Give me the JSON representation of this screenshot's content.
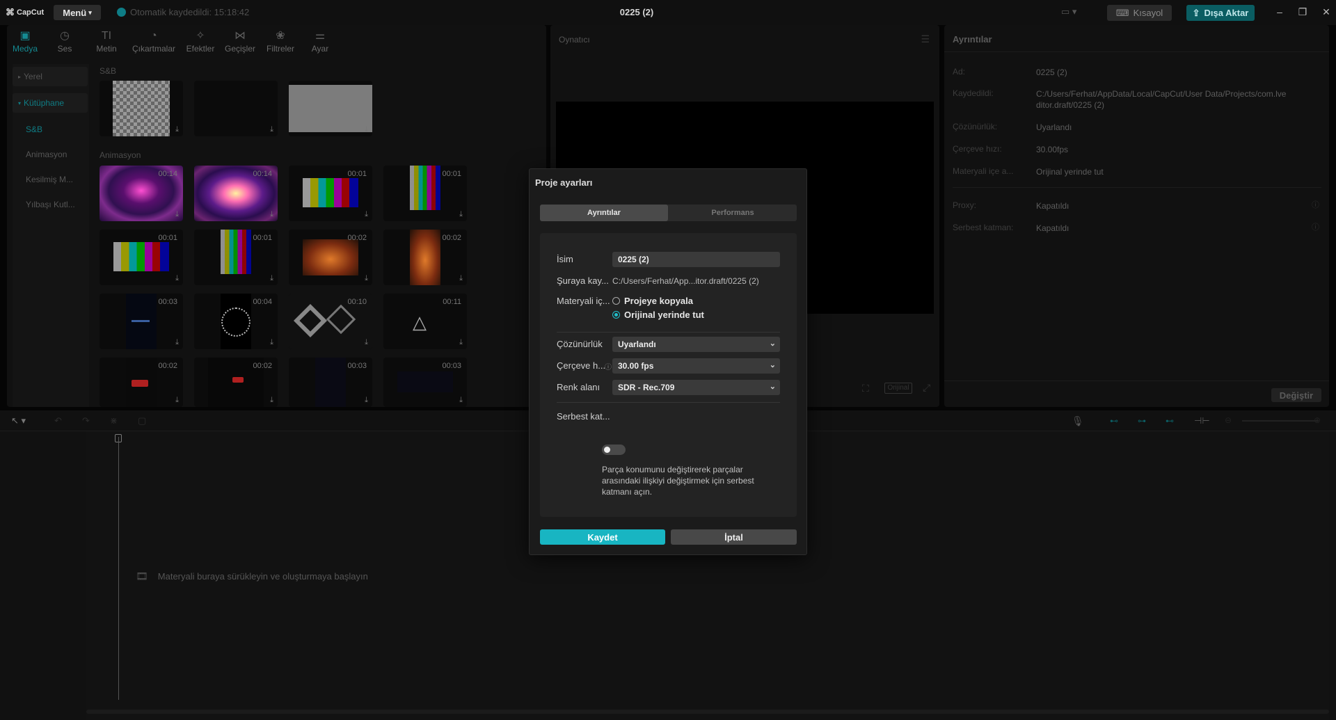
{
  "app": {
    "logo": "CapCut",
    "menu_label": "Menü",
    "autosave_text": "Otomatik kaydedildi: 15:18:42",
    "project_title": "0225 (2)",
    "shortcut_label": "Kısayol",
    "export_label": "Dışa Aktar"
  },
  "toolbar": {
    "items": [
      {
        "label": "Medya",
        "icon": "media-icon"
      },
      {
        "label": "Ses",
        "icon": "audio-icon"
      },
      {
        "label": "Metin",
        "icon": "text-icon"
      },
      {
        "label": "Çıkartmalar",
        "icon": "sticker-icon"
      },
      {
        "label": "Efektler",
        "icon": "effects-icon"
      },
      {
        "label": "Geçişler",
        "icon": "transitions-icon"
      },
      {
        "label": "Filtreler",
        "icon": "filters-icon"
      },
      {
        "label": "Ayar",
        "icon": "adjust-icon"
      }
    ]
  },
  "sidenav": {
    "local": "Yerel",
    "library": "Kütüphane",
    "items": [
      "S&B",
      "Animasyon",
      "Kesilmiş M...",
      "Yılbaşı Kutl..."
    ]
  },
  "media": {
    "section_sb": "S&B",
    "section_anim": "Animasyon",
    "durations": [
      "00:14",
      "00:14",
      "00:01",
      "00:01",
      "00:01",
      "00:01",
      "00:02",
      "00:02",
      "00:03",
      "00:04",
      "00:10",
      "00:11",
      "00:02",
      "00:02",
      "00:03",
      "00:03"
    ]
  },
  "player": {
    "header": "Oynatıcı",
    "ratio_label": "Orijinal"
  },
  "details": {
    "header": "Ayrıntılar",
    "rows": [
      {
        "key": "Ad:",
        "value": "0225 (2)"
      },
      {
        "key": "Kaydedildi:",
        "value": "C:/Users/Ferhat/AppData/Local/CapCut/User Data/Projects/com.lveditor.draft/0225 (2)"
      },
      {
        "key": "Çözünürlük:",
        "value": "Uyarlandı"
      },
      {
        "key": "Çerçeve hızı:",
        "value": "30.00fps"
      },
      {
        "key": "Materyali içe a...",
        "value": "Orijinal yerinde tut"
      },
      {
        "key": "Proxy:",
        "value": "Kapatıldı"
      },
      {
        "key": "Serbest katman:",
        "value": "Kapatıldı"
      }
    ],
    "change_label": "Değiştir"
  },
  "timeline": {
    "drop_hint": "Materyali buraya sürükleyin ve oluşturmaya başlayın"
  },
  "modal": {
    "title": "Proje ayarları",
    "tab_details": "Ayrıntılar",
    "tab_performance": "Performans",
    "name_label": "İsim",
    "name_value": "0225 (2)",
    "save_to_label": "Şuraya kay...",
    "save_to_value": "C:/Users/Ferhat/App...itor.draft/0225 (2)",
    "import_label": "Materyali iç...",
    "radio_copy": "Projeye kopyala",
    "radio_keep": "Orijinal yerinde tut",
    "resolution_label": "Çözünürlük",
    "resolution_value": "Uyarlandı",
    "framerate_label": "Çerçeve h...",
    "framerate_value": "30.00 fps",
    "colorspace_label": "Renk alanı",
    "colorspace_value": "SDR - Rec.709",
    "free_layer_label": "Serbest kat...",
    "free_layer_on": false,
    "free_layer_desc": "Parça konumunu değiştirerek parçalar arasındaki ilişkiyi değiştirmek için serbest katmanı açın.",
    "save_label": "Kaydet",
    "cancel_label": "İptal"
  },
  "colors": {
    "accent": "#18b5c2",
    "export_bg": "#0a5d62"
  }
}
